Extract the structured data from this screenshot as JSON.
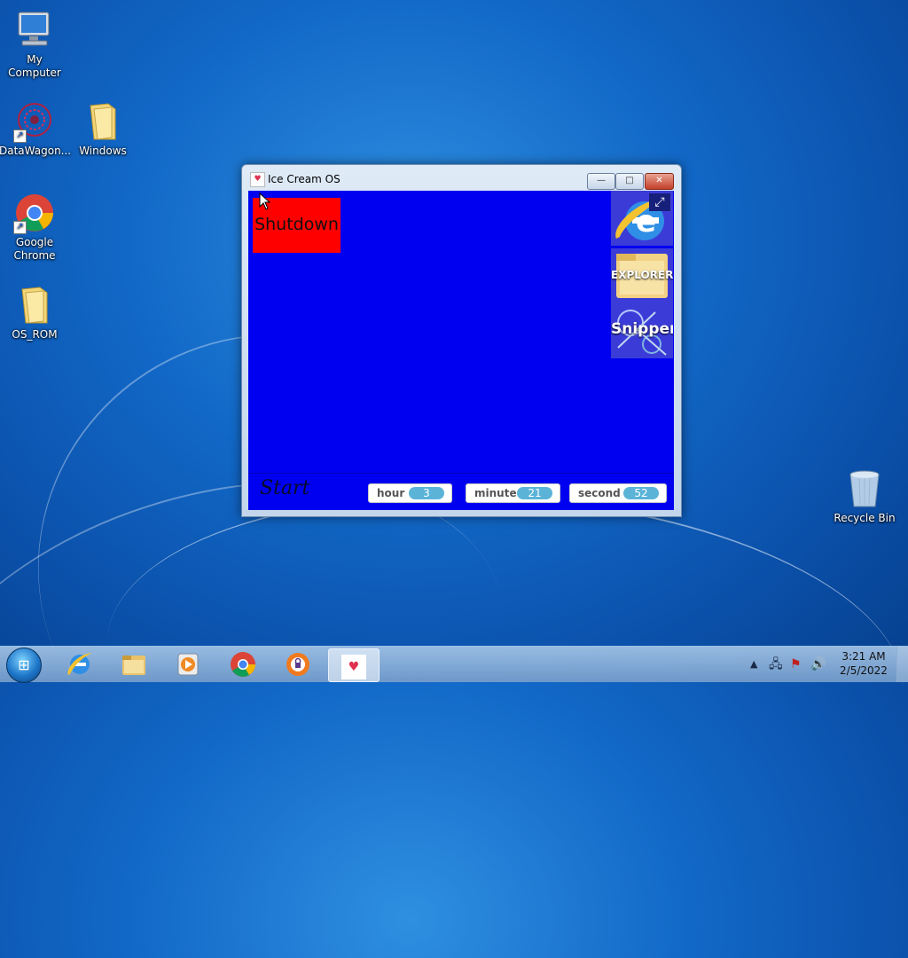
{
  "desktop": {
    "icons": [
      {
        "label": "My Computer",
        "icon": "computer-icon"
      },
      {
        "label": "DataWagon...",
        "icon": "datawagon-icon"
      },
      {
        "label": "Windows",
        "icon": "folder-icon"
      },
      {
        "label": "Google Chrome",
        "icon": "chrome-icon"
      },
      {
        "label": "OS_ROM",
        "icon": "folder-icon"
      },
      {
        "label": "Recycle Bin",
        "icon": "recycle-bin-icon"
      }
    ]
  },
  "window": {
    "title": "Ice Cream OS",
    "controls": {
      "minimize": "—",
      "maximize": "□",
      "close": "✕"
    },
    "shutdown_label": "Shutdown",
    "side_apps": [
      {
        "label": "",
        "icon": "internet-explorer-icon"
      },
      {
        "label": "EXPLORER",
        "icon": "folder-icon"
      },
      {
        "label": "Snipper",
        "icon": "scissors-icon"
      }
    ],
    "start_label": "Start",
    "time": {
      "hour_label": "hour",
      "hour": "3",
      "minute_label": "minute",
      "minute": "21",
      "second_label": "second",
      "second": "52"
    },
    "colors": {
      "client_bg": "#0000f0",
      "shutdown_bg": "#ff0000"
    }
  },
  "taskbar": {
    "items": [
      "internet-explorer-icon",
      "file-explorer-icon",
      "media-player-icon",
      "chrome-icon",
      "vpn-icon",
      "ice-cream-os-icon"
    ],
    "clock_time": "3:21 AM",
    "clock_date": "2/5/2022"
  }
}
